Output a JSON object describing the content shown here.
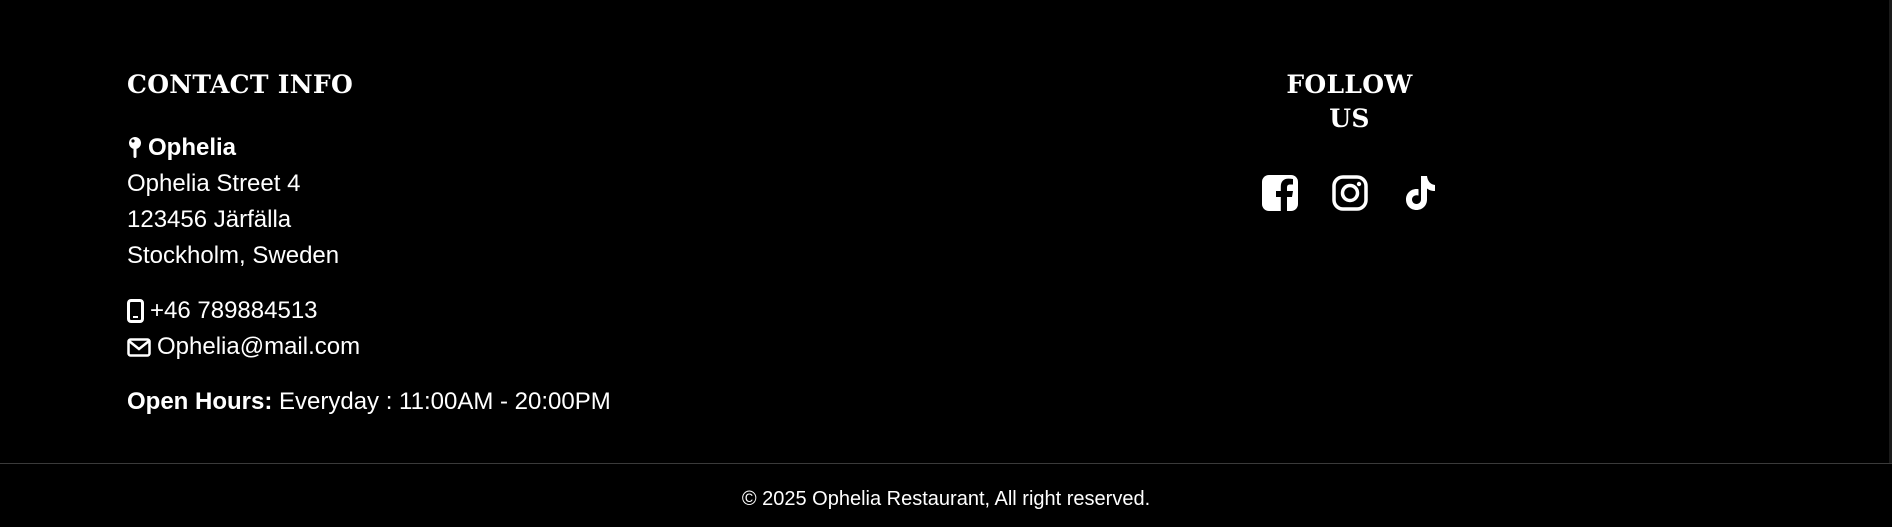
{
  "contact": {
    "title": "CONTACT INFO",
    "name": "Ophelia",
    "street": "Ophelia Street 4",
    "postal": "123456 Järfälla",
    "city": "Stockholm, Sweden",
    "phone": "+46 789884513",
    "email": "Ophelia@mail.com",
    "hours_label": "Open Hours:",
    "hours_value": " Everyday : 11:00AM - 20:00PM"
  },
  "follow": {
    "title": "FOLLOW US",
    "icons": [
      "facebook-icon",
      "instagram-icon",
      "tiktok-icon"
    ]
  },
  "footer": {
    "copyright": "© 2025 Ophelia Restaurant, All right reserved."
  },
  "colors": {
    "background": "#000000",
    "text": "#ffffff",
    "divider": "#3a3a3a"
  }
}
